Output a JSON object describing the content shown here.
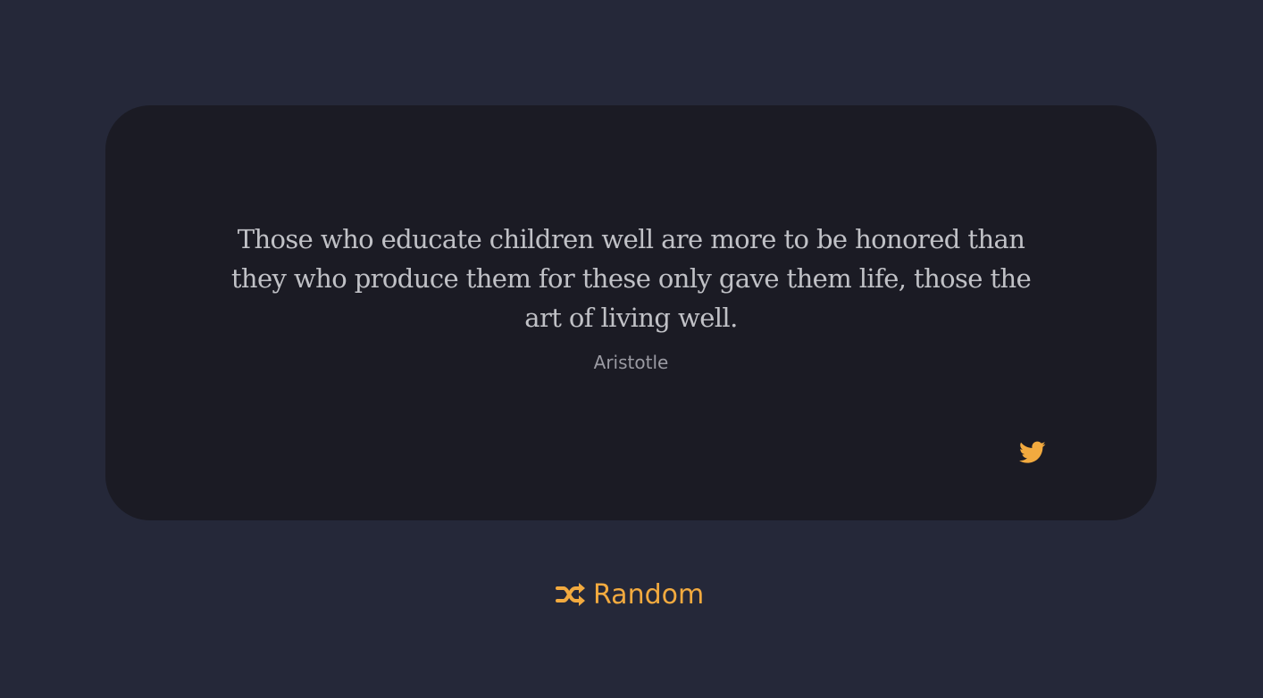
{
  "quote": {
    "text": "Those who educate children well are more to be honored than they who produce them for these only gave them life, those the art of living well.",
    "author": "Aristotle"
  },
  "actions": {
    "tweet_icon": "twitter-icon",
    "random_icon": "shuffle-icon",
    "random_label": "Random"
  },
  "colors": {
    "background": "#252839",
    "card": "#1b1b24",
    "accent": "#f2aa3f",
    "quote_text": "#c0c1c6",
    "author_text": "#9a9aa2"
  }
}
